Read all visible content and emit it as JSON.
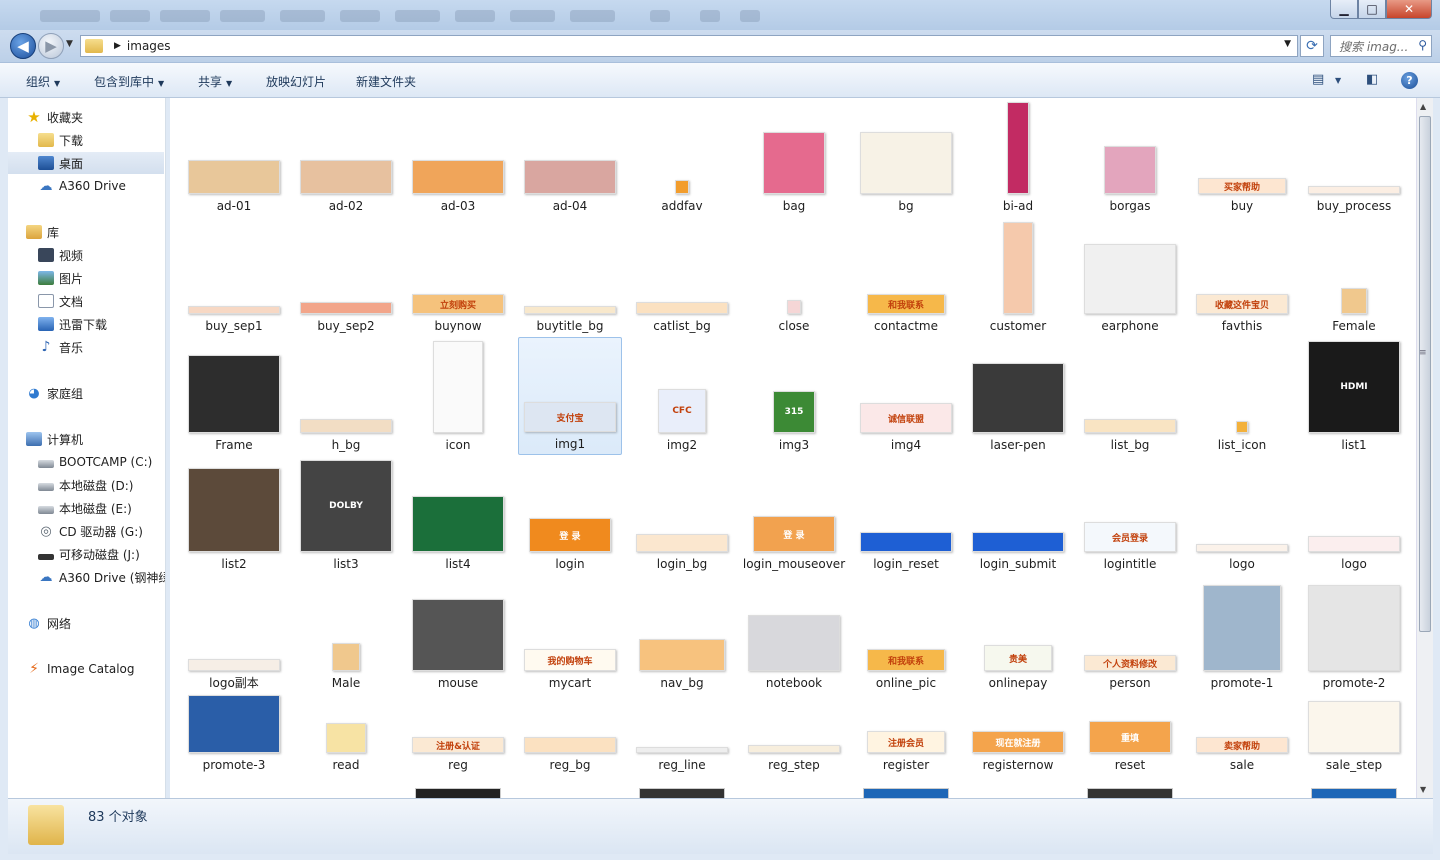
{
  "window": {
    "min": "▁",
    "max": "□",
    "close": "✕"
  },
  "address": {
    "crumb": "images",
    "search_placeholder": "搜索 imag..."
  },
  "toolbar": {
    "organize": "组织",
    "include": "包含到库中",
    "share": "共享",
    "slideshow": "放映幻灯片",
    "newfolder": "新建文件夹"
  },
  "sidebar": {
    "favorites": "收藏夹",
    "downloads": "下载",
    "desktop": "桌面",
    "a360": "A360 Drive",
    "libraries": "库",
    "video": "视频",
    "pictures": "图片",
    "docs": "文档",
    "xunlei": "迅雷下载",
    "music": "音乐",
    "homegroup": "家庭组",
    "computer": "计算机",
    "c": "BOOTCAMP (C:)",
    "d": "本地磁盘 (D:)",
    "e": "本地磁盘 (E:)",
    "g": "CD 驱动器 (G:)",
    "j": "可移动磁盘 (J:)",
    "a360b": "A360 Drive (钢神绿",
    "network": "网络",
    "catalog": "Image Catalog"
  },
  "files": [
    {
      "name": "ad-01",
      "color": "#e8c79a"
    },
    {
      "name": "ad-02",
      "color": "#e7c19f"
    },
    {
      "name": "ad-03",
      "color": "#f0a55a"
    },
    {
      "name": "ad-04",
      "color": "#d9a6a0"
    },
    {
      "name": "addfav",
      "color": "#f29d2d"
    },
    {
      "name": "bag",
      "color": "#e56a8e"
    },
    {
      "name": "bg",
      "color": "#f7f2e6"
    },
    {
      "name": "bi-ad",
      "color": "#c22b63"
    },
    {
      "name": "borgas",
      "color": "#e3a5bd"
    },
    {
      "name": "buy",
      "text": "买家帮助",
      "color": "#fde6d1"
    },
    {
      "name": "buy_process",
      "color": "#fbeee3"
    },
    {
      "name": "buy_sep1",
      "color": "#f7d8c4"
    },
    {
      "name": "buy_sep2",
      "color": "#f2a58a"
    },
    {
      "name": "buynow",
      "text": "立刻购买",
      "color": "#f5c27c"
    },
    {
      "name": "buytitle_bg",
      "color": "#f8e8cc"
    },
    {
      "name": "catlist_bg",
      "color": "#fbe1c1"
    },
    {
      "name": "close",
      "color": "#f5d6d6"
    },
    {
      "name": "contactme",
      "text": "和我联系",
      "color": "#f6b84a"
    },
    {
      "name": "customer",
      "color": "#f5c9ac"
    },
    {
      "name": "earphone",
      "color": "#f0f0f0"
    },
    {
      "name": "favthis",
      "text": "收藏这件宝贝",
      "color": "#fbe9d3"
    },
    {
      "name": "Female",
      "color": "#f0c88d"
    },
    {
      "name": "Frame",
      "color": "#2d2d2d"
    },
    {
      "name": "h_bg",
      "color": "#f2ddc4"
    },
    {
      "name": "icon",
      "color": "#fafafa"
    },
    {
      "name": "img1",
      "text": "支付宝",
      "color": "#dde6f2"
    },
    {
      "name": "img2",
      "text": "CFC",
      "color": "#e9eefa"
    },
    {
      "name": "img3",
      "text": "315",
      "color": "#3c8a35"
    },
    {
      "name": "img4",
      "text": "诚信联盟",
      "color": "#fbe8e8"
    },
    {
      "name": "laser-pen",
      "color": "#3a3a3a"
    },
    {
      "name": "list_bg",
      "color": "#f9e4c3"
    },
    {
      "name": "list_icon",
      "color": "#f3b13b"
    },
    {
      "name": "list1",
      "text": "HDMI",
      "color": "#1a1a1a"
    },
    {
      "name": "list2",
      "color": "#5c4a3a"
    },
    {
      "name": "list3",
      "text": "DOLBY",
      "color": "#444"
    },
    {
      "name": "list4",
      "color": "#1b6f3a"
    },
    {
      "name": "login",
      "text": "登 录",
      "color": "#f08a1e"
    },
    {
      "name": "login_bg",
      "color": "#fbe7cf"
    },
    {
      "name": "login_mouseover",
      "text": "登 录",
      "color": "#f2a24f"
    },
    {
      "name": "login_reset",
      "color": "#1e5fd4"
    },
    {
      "name": "login_submit",
      "color": "#1e5fd4"
    },
    {
      "name": "logintitle",
      "text": "会员登录",
      "color": "#f4f8fc"
    },
    {
      "name": "logo",
      "color": "#fbf2ea"
    },
    {
      "name": "logo",
      "color": "#fbeeee"
    },
    {
      "name": "logo副本",
      "color": "#f6eee6"
    },
    {
      "name": "Male",
      "color": "#f0c88d"
    },
    {
      "name": "mouse",
      "color": "#555"
    },
    {
      "name": "mycart",
      "text": "我的购物车",
      "color": "#fffaf0"
    },
    {
      "name": "nav_bg",
      "color": "#f7c27e"
    },
    {
      "name": "notebook",
      "color": "#d8d8dc"
    },
    {
      "name": "online_pic",
      "text": "和我联系",
      "color": "#f6b84a"
    },
    {
      "name": "onlinepay",
      "text": "贵美",
      "color": "#f6f8ee"
    },
    {
      "name": "person",
      "text": "个人资料修改",
      "color": "#fbe9d3"
    },
    {
      "name": "promote-1",
      "color": "#9fb6cc"
    },
    {
      "name": "promote-2",
      "color": "#e5e5e5"
    },
    {
      "name": "promote-3",
      "color": "#2a5ea8"
    },
    {
      "name": "read",
      "color": "#f7e3a4"
    },
    {
      "name": "reg",
      "text": "注册&认证",
      "color": "#fbe9d3"
    },
    {
      "name": "reg_bg",
      "color": "#fbe1c1"
    },
    {
      "name": "reg_line",
      "color": "#eee"
    },
    {
      "name": "reg_step",
      "color": "#f7eedd"
    },
    {
      "name": "register",
      "text": "注册会员",
      "color": "#fff4e1"
    },
    {
      "name": "registernow",
      "text": "现在就注册",
      "color": "#f4a44c"
    },
    {
      "name": "reset",
      "text": "重填",
      "color": "#f4a44c"
    },
    {
      "name": "sale",
      "text": "卖家帮助",
      "color": "#fde6d1"
    },
    {
      "name": "sale_step",
      "color": "#fbf6ec"
    }
  ],
  "status": {
    "count": "83 个对象"
  }
}
